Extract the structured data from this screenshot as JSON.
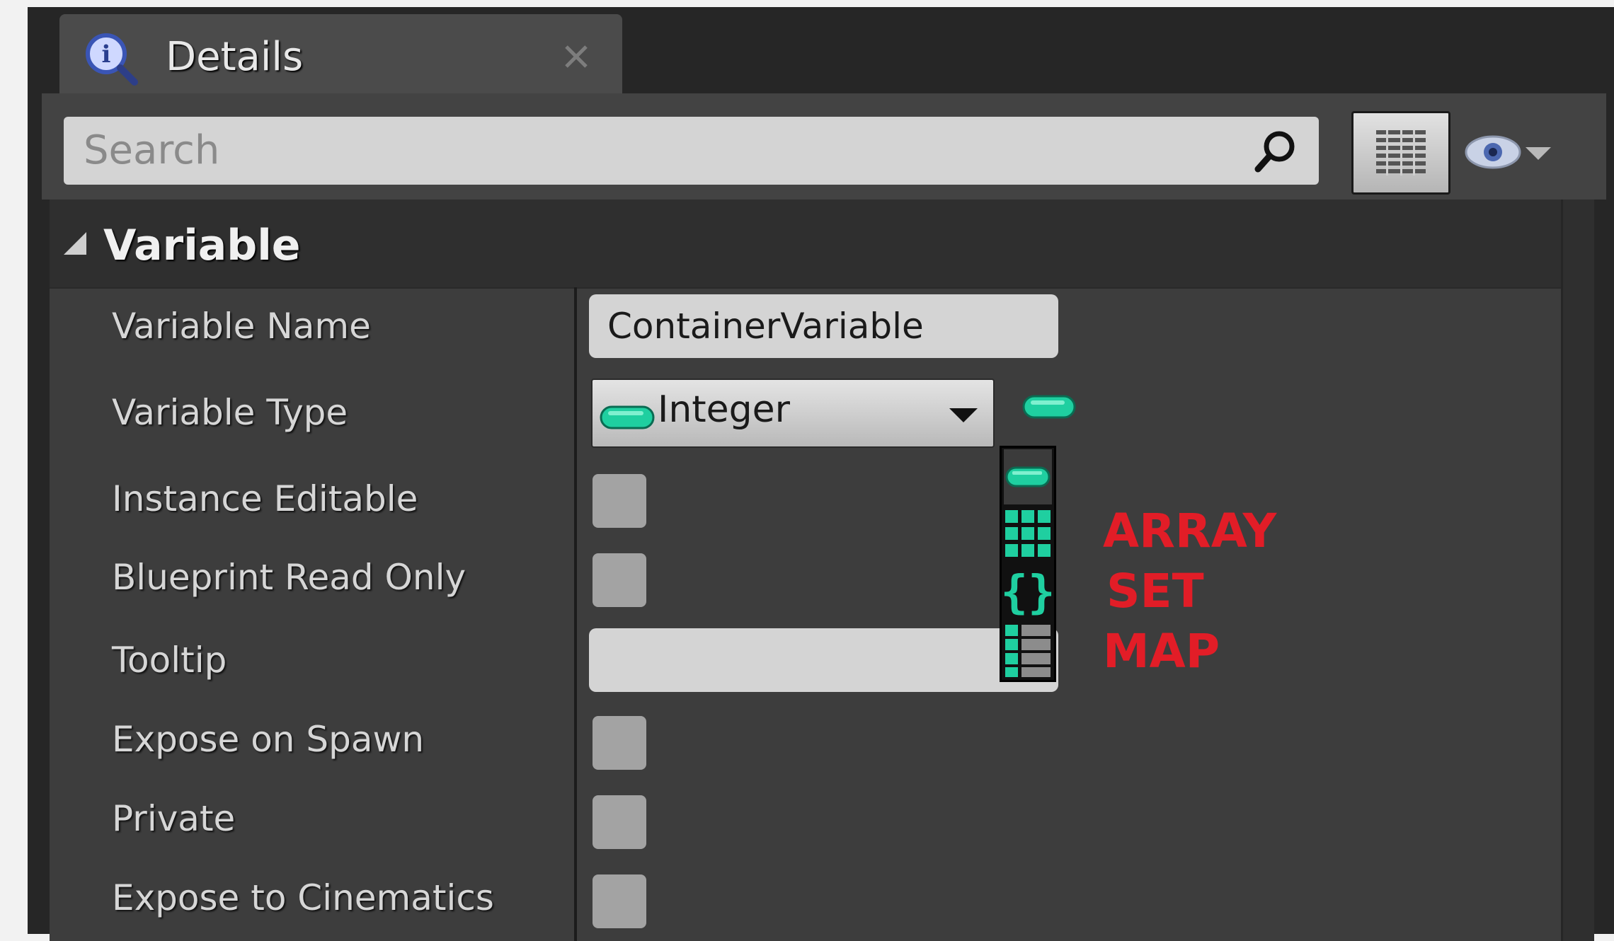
{
  "tab": {
    "title": "Details"
  },
  "toolbar": {
    "search_placeholder": "Search"
  },
  "category": {
    "title": "Variable"
  },
  "rows": {
    "variable_name": {
      "label": "Variable Name",
      "value": "ContainerVariable"
    },
    "variable_type": {
      "label": "Variable Type",
      "value": "Integer"
    },
    "instance_editable": {
      "label": "Instance Editable",
      "checked": false
    },
    "blueprint_read_only": {
      "label": "Blueprint Read Only",
      "checked": false
    },
    "tooltip": {
      "label": "Tooltip",
      "value": ""
    },
    "expose_on_spawn": {
      "label": "Expose on Spawn",
      "checked": false
    },
    "private": {
      "label": "Private",
      "checked": false
    },
    "expose_to_cinematics": {
      "label": "Expose to Cinematics",
      "checked": false
    }
  },
  "container_menu": {
    "options": [
      "single-variable",
      "array",
      "set",
      "map"
    ],
    "icon_color": "#1fcfa0"
  },
  "annotations": {
    "array": "ARRAY",
    "set": "SET",
    "map": "MAP",
    "color": "#e21d27"
  }
}
